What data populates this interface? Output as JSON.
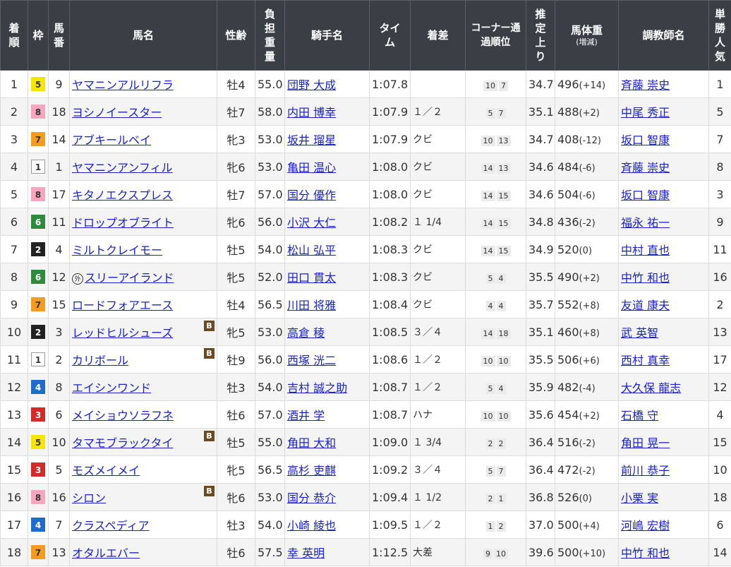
{
  "headers": {
    "rank": "着順",
    "waku": "枠",
    "num": "馬番",
    "name": "馬名",
    "sexage": "性齢",
    "weight": "負担重量",
    "jockey": "騎手名",
    "time": "タイム",
    "margin": "着差",
    "corner": "コーナー通過順位",
    "agari": "推定上り",
    "bodyweight": "馬体重",
    "bodyweight_sub": "(増減)",
    "trainer": "調教師名",
    "pop": "単勝人気"
  },
  "waku_colors": {
    "1": {
      "bg": "#ffffff",
      "fg": "#333333",
      "border": "#999999"
    },
    "2": {
      "bg": "#222222",
      "fg": "#ffffff",
      "border": "#222222"
    },
    "3": {
      "bg": "#d42a2a",
      "fg": "#ffffff",
      "border": "#d42a2a"
    },
    "4": {
      "bg": "#1f6ccf",
      "fg": "#ffffff",
      "border": "#1f6ccf"
    },
    "5": {
      "bg": "#f5e600",
      "fg": "#333333",
      "border": "#f5e600"
    },
    "6": {
      "bg": "#2e8b3d",
      "fg": "#ffffff",
      "border": "#2e8b3d"
    },
    "7": {
      "bg": "#f59b1e",
      "fg": "#333333",
      "border": "#f59b1e"
    },
    "8": {
      "bg": "#f6a7bf",
      "fg": "#333333",
      "border": "#f6a7bf"
    }
  },
  "rows": [
    {
      "rank": "1",
      "waku": "5",
      "num": "9",
      "name": "ヤマニンアルリフラ",
      "mark": "",
      "blinker": "",
      "sexage": "牡4",
      "weight": "55.0",
      "jockey": "団野 大成",
      "time": "1:07.8",
      "margin": "",
      "corner": [
        "10",
        "7"
      ],
      "agari": "34.7",
      "bw": "496",
      "bwc": "(+14)",
      "trainer": "斉藤 崇史",
      "pop": "1"
    },
    {
      "rank": "2",
      "waku": "8",
      "num": "18",
      "name": "ヨシノイースター",
      "mark": "",
      "blinker": "",
      "sexage": "牡7",
      "weight": "58.0",
      "jockey": "内田 博幸",
      "time": "1:07.9",
      "margin": "１／２",
      "corner": [
        "5",
        "7"
      ],
      "agari": "35.1",
      "bw": "488",
      "bwc": "(+2)",
      "trainer": "中尾 秀正",
      "pop": "5"
    },
    {
      "rank": "3",
      "waku": "7",
      "num": "14",
      "name": "アブキールベイ",
      "mark": "",
      "blinker": "",
      "sexage": "牝3",
      "weight": "53.0",
      "jockey": "坂井 瑠星",
      "time": "1:07.9",
      "margin": "クビ",
      "corner": [
        "10",
        "13"
      ],
      "agari": "34.7",
      "bw": "408",
      "bwc": "(-12)",
      "trainer": "坂口 智康",
      "pop": "7"
    },
    {
      "rank": "4",
      "waku": "1",
      "num": "1",
      "name": "ヤマニンアンフィル",
      "mark": "",
      "blinker": "",
      "sexage": "牝6",
      "weight": "53.0",
      "jockey": "亀田 温心",
      "time": "1:08.0",
      "margin": "クビ",
      "corner": [
        "14",
        "13"
      ],
      "agari": "34.6",
      "bw": "484",
      "bwc": "(-6)",
      "trainer": "斉藤 崇史",
      "pop": "8"
    },
    {
      "rank": "5",
      "waku": "8",
      "num": "17",
      "name": "キタノエクスプレス",
      "mark": "",
      "blinker": "",
      "sexage": "牡7",
      "weight": "57.0",
      "jockey": "国分 優作",
      "time": "1:08.0",
      "margin": "クビ",
      "corner": [
        "14",
        "15"
      ],
      "agari": "34.6",
      "bw": "504",
      "bwc": "(-6)",
      "trainer": "坂口 智康",
      "pop": "3"
    },
    {
      "rank": "6",
      "waku": "6",
      "num": "11",
      "name": "ドロップオブライト",
      "mark": "",
      "blinker": "",
      "sexage": "牝6",
      "weight": "56.0",
      "jockey": "小沢 大仁",
      "time": "1:08.2",
      "margin": "１ 1/4",
      "corner": [
        "14",
        "15"
      ],
      "agari": "34.8",
      "bw": "436",
      "bwc": "(-2)",
      "trainer": "福永 祐一",
      "pop": "9"
    },
    {
      "rank": "7",
      "waku": "2",
      "num": "4",
      "name": "ミルトクレイモー",
      "mark": "",
      "blinker": "",
      "sexage": "牡5",
      "weight": "54.0",
      "jockey": "松山 弘平",
      "time": "1:08.3",
      "margin": "クビ",
      "corner": [
        "14",
        "15"
      ],
      "agari": "34.9",
      "bw": "520",
      "bwc": "(0)",
      "trainer": "中村 直也",
      "pop": "11"
    },
    {
      "rank": "8",
      "waku": "6",
      "num": "12",
      "name": "スリーアイランド",
      "mark": "外",
      "blinker": "",
      "sexage": "牝5",
      "weight": "52.0",
      "jockey": "田口 貫太",
      "time": "1:08.3",
      "margin": "クビ",
      "corner": [
        "5",
        "4"
      ],
      "agari": "35.5",
      "bw": "490",
      "bwc": "(+2)",
      "trainer": "中竹 和也",
      "pop": "16"
    },
    {
      "rank": "9",
      "waku": "7",
      "num": "15",
      "name": "ロードフォアエース",
      "mark": "",
      "blinker": "",
      "sexage": "牡4",
      "weight": "56.5",
      "jockey": "川田 将雅",
      "time": "1:08.4",
      "margin": "クビ",
      "corner": [
        "4",
        "4"
      ],
      "agari": "35.7",
      "bw": "552",
      "bwc": "(+8)",
      "trainer": "友道 康夫",
      "pop": "2"
    },
    {
      "rank": "10",
      "waku": "2",
      "num": "3",
      "name": "レッドヒルシューズ",
      "mark": "",
      "blinker": "B",
      "sexage": "牝5",
      "weight": "53.0",
      "jockey": "高倉 稜",
      "time": "1:08.5",
      "margin": "３／４",
      "corner": [
        "14",
        "18"
      ],
      "agari": "35.1",
      "bw": "460",
      "bwc": "(+8)",
      "trainer": "武 英智",
      "pop": "13"
    },
    {
      "rank": "11",
      "waku": "1",
      "num": "2",
      "name": "カリボール",
      "mark": "",
      "blinker": "B",
      "sexage": "牡9",
      "weight": "56.0",
      "jockey": "西塚 洸二",
      "time": "1:08.6",
      "margin": "１／２",
      "corner": [
        "10",
        "10"
      ],
      "agari": "35.5",
      "bw": "506",
      "bwc": "(+6)",
      "trainer": "西村 真幸",
      "pop": "17"
    },
    {
      "rank": "12",
      "waku": "4",
      "num": "8",
      "name": "エイシンワンド",
      "mark": "",
      "blinker": "",
      "sexage": "牡3",
      "weight": "54.0",
      "jockey": "吉村 誠之助",
      "time": "1:08.7",
      "margin": "１／２",
      "corner": [
        "5",
        "4"
      ],
      "agari": "35.9",
      "bw": "482",
      "bwc": "(-4)",
      "trainer": "大久保 龍志",
      "pop": "12"
    },
    {
      "rank": "13",
      "waku": "3",
      "num": "6",
      "name": "メイショウソラフネ",
      "mark": "",
      "blinker": "",
      "sexage": "牡6",
      "weight": "57.0",
      "jockey": "酒井 学",
      "time": "1:08.7",
      "margin": "ハナ",
      "corner": [
        "10",
        "10"
      ],
      "agari": "35.6",
      "bw": "454",
      "bwc": "(+2)",
      "trainer": "石橋 守",
      "pop": "4"
    },
    {
      "rank": "14",
      "waku": "5",
      "num": "10",
      "name": "タマモブラックタイ",
      "mark": "",
      "blinker": "B",
      "sexage": "牡5",
      "weight": "55.0",
      "jockey": "角田 大和",
      "time": "1:09.0",
      "margin": "１ 3/4",
      "corner": [
        "2",
        "2"
      ],
      "agari": "36.4",
      "bw": "516",
      "bwc": "(-2)",
      "trainer": "角田 晃一",
      "pop": "15"
    },
    {
      "rank": "15",
      "waku": "3",
      "num": "5",
      "name": "モズメイメイ",
      "mark": "",
      "blinker": "",
      "sexage": "牝5",
      "weight": "56.5",
      "jockey": "高杉 吏麒",
      "time": "1:09.2",
      "margin": "３／４",
      "corner": [
        "5",
        "7"
      ],
      "agari": "36.4",
      "bw": "472",
      "bwc": "(-2)",
      "trainer": "前川 恭子",
      "pop": "10"
    },
    {
      "rank": "16",
      "waku": "8",
      "num": "16",
      "name": "シロン",
      "mark": "",
      "blinker": "B",
      "sexage": "牝6",
      "weight": "53.0",
      "jockey": "国分 恭介",
      "time": "1:09.4",
      "margin": "１ 1/2",
      "corner": [
        "2",
        "1"
      ],
      "agari": "36.8",
      "bw": "526",
      "bwc": "(0)",
      "trainer": "小栗 実",
      "pop": "18"
    },
    {
      "rank": "17",
      "waku": "4",
      "num": "7",
      "name": "クラスペディア",
      "mark": "",
      "blinker": "",
      "sexage": "牡3",
      "weight": "54.0",
      "jockey": "小崎 綾也",
      "time": "1:09.5",
      "margin": "１／２",
      "corner": [
        "1",
        "2"
      ],
      "agari": "37.0",
      "bw": "500",
      "bwc": "(+4)",
      "trainer": "河嶋 宏樹",
      "pop": "6"
    },
    {
      "rank": "18",
      "waku": "7",
      "num": "13",
      "name": "オタルエバー",
      "mark": "",
      "blinker": "",
      "sexage": "牡6",
      "weight": "57.5",
      "jockey": "幸 英明",
      "time": "1:12.5",
      "margin": "大差",
      "corner": [
        "9",
        "10"
      ],
      "agari": "39.6",
      "bw": "500",
      "bwc": "(+10)",
      "trainer": "中竹 和也",
      "pop": "14"
    }
  ]
}
